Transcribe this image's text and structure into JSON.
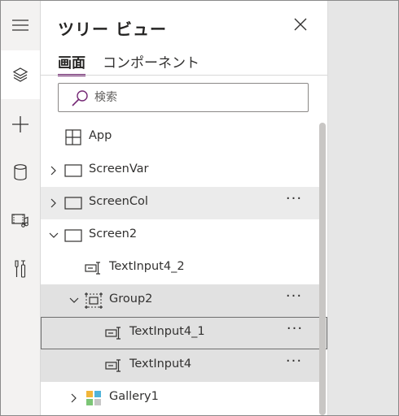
{
  "panel": {
    "title": "ツリー ビュー",
    "tabs": [
      {
        "label": "画面",
        "selected": true
      },
      {
        "label": "コンポーネント",
        "selected": false
      }
    ],
    "search": {
      "placeholder": "検索",
      "value": ""
    }
  },
  "rail": {
    "items": [
      {
        "icon": "hamburger-menu-icon"
      },
      {
        "icon": "layers-tree-view-icon",
        "active": true
      },
      {
        "icon": "plus-insert-icon"
      },
      {
        "icon": "database-icon"
      },
      {
        "icon": "media-icon"
      },
      {
        "icon": "advanced-tools-icon"
      }
    ]
  },
  "tree": {
    "app": {
      "label": "App",
      "icon": "app-icon"
    },
    "items": [
      {
        "label": "ScreenVar",
        "icon": "screen-icon",
        "expanded": false,
        "more": false
      },
      {
        "label": "ScreenCol",
        "icon": "screen-icon",
        "expanded": false,
        "more": true
      },
      {
        "label": "Screen2",
        "icon": "screen-icon",
        "expanded": true,
        "more": false
      },
      {
        "label": "TextInput4_2",
        "icon": "text-input-icon",
        "more": false
      },
      {
        "label": "Group2",
        "icon": "group-icon",
        "expanded": true,
        "more": true
      },
      {
        "label": "TextInput4_1",
        "icon": "text-input-icon",
        "more": true,
        "selected": true
      },
      {
        "label": "TextInput4",
        "icon": "text-input-icon",
        "more": true
      },
      {
        "label": "Gallery1",
        "icon": "gallery-icon",
        "expanded": false,
        "more": false
      }
    ],
    "more_label": "···"
  }
}
